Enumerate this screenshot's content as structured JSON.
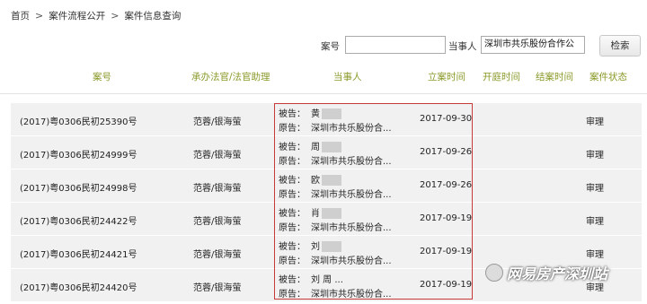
{
  "breadcrumb": {
    "home": "首页",
    "flow": "案件流程公开",
    "query": "案件信息查询",
    "sep": ">"
  },
  "search": {
    "case_no_label": "案号",
    "case_no_value": "",
    "party_label": "当事人",
    "party_value": "深圳市共乐股份合作公",
    "button_label": "检索"
  },
  "table": {
    "headers": [
      "案号",
      "承办法官/法官助理",
      "当事人",
      "立案时间",
      "开庭时间",
      "结案时间",
      "案件状态"
    ],
    "rows": [
      {
        "case_no": "(2017)粤0306民初25390号",
        "judge": "范蓉/银海萤",
        "party1_label": "被告：",
        "party1_value": "黄",
        "party2_label": "原告：",
        "party2_value": "深圳市共乐股份合...",
        "filing_date": "2017-09-30",
        "status": "审理"
      },
      {
        "case_no": "(2017)粤0306民初24999号",
        "judge": "范蓉/银海萤",
        "party1_label": "被告：",
        "party1_value": "周",
        "party2_label": "原告：",
        "party2_value": "深圳市共乐股份合...",
        "filing_date": "2017-09-26",
        "status": "审理"
      },
      {
        "case_no": "(2017)粤0306民初24998号",
        "judge": "范蓉/银海萤",
        "party1_label": "被告：",
        "party1_value": "欧",
        "party2_label": "原告：",
        "party2_value": "深圳市共乐股份合...",
        "filing_date": "2017-09-26",
        "status": "审理"
      },
      {
        "case_no": "(2017)粤0306民初24422号",
        "judge": "范蓉/银海萤",
        "party1_label": "被告：",
        "party1_value": "肖",
        "party2_label": "原告：",
        "party2_value": "深圳市共乐股份合...",
        "filing_date": "2017-09-19",
        "status": "审理"
      },
      {
        "case_no": "(2017)粤0306民初24421号",
        "judge": "范蓉/银海萤",
        "party1_label": "被告：",
        "party1_value": "刘",
        "party2_label": "原告：",
        "party2_value": "深圳市共乐股份合...",
        "filing_date": "2017-09-19",
        "status": "审理"
      },
      {
        "case_no": "(2017)粤0306民初24420号",
        "judge": "范蓉/银海萤",
        "party1_label": "被告：",
        "party1_value": "刘        周        ...",
        "party2_label": "原告：",
        "party2_value": "深圳市共乐股份合...",
        "filing_date": "2017-09-19",
        "status": "审理"
      }
    ]
  },
  "watermark": {
    "text": "网易房产深圳站"
  },
  "colors": {
    "header_text": "#8a9a2a",
    "highlight_border": "#c63a3a",
    "row_bg": "#f1f1f1"
  }
}
